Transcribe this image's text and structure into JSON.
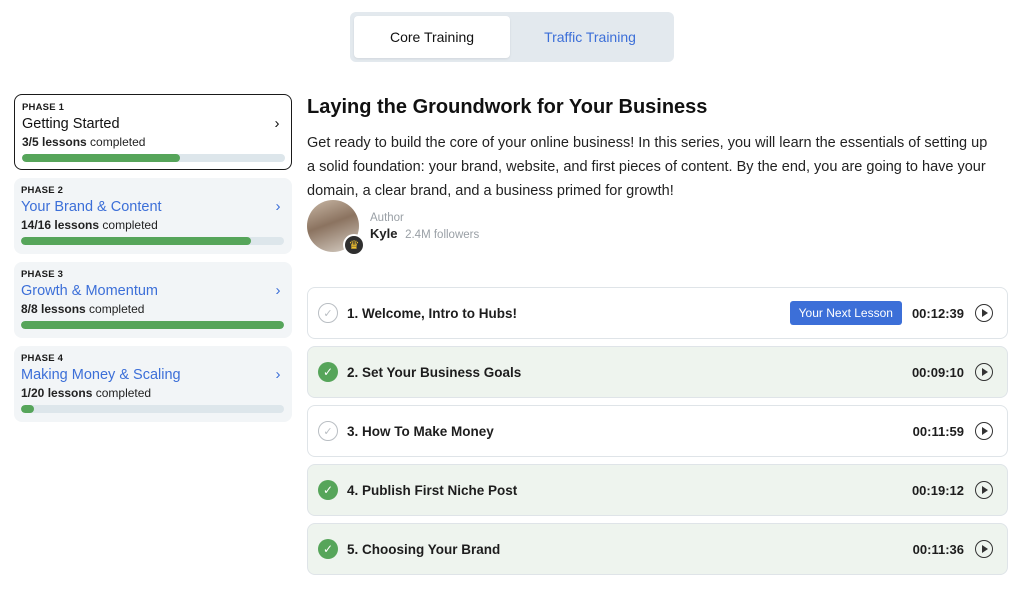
{
  "tabs": [
    {
      "label": "Core Training",
      "active": true
    },
    {
      "label": "Traffic Training",
      "active": false
    }
  ],
  "phases": [
    {
      "kicker": "PHASE 1",
      "title": "Getting Started",
      "completed": "3/5 lessons",
      "suffix": " completed",
      "progress": 0.6
    },
    {
      "kicker": "PHASE 2",
      "title": "Your Brand & Content",
      "completed": "14/16 lessons",
      "suffix": " completed",
      "progress": 0.875
    },
    {
      "kicker": "PHASE 3",
      "title": "Growth & Momentum",
      "completed": "8/8 lessons",
      "suffix": " completed",
      "progress": 1.0
    },
    {
      "kicker": "PHASE 4",
      "title": "Making Money & Scaling",
      "completed": "1/20 lessons",
      "suffix": " completed",
      "progress": 0.05
    }
  ],
  "main": {
    "title": "Laying the Groundwork for Your Business",
    "description": "Get ready to build the core of your online business! In this series, you will learn the essentials of setting up a solid foundation: your brand, website, and first pieces of content. By the end, you are going to have your domain, a clear brand, and a business primed for growth!",
    "author": {
      "label": "Author",
      "name": "Kyle",
      "followers": "2.4M followers"
    }
  },
  "lessons": [
    {
      "title": "1. Welcome, Intro to Hubs!",
      "duration": "00:12:39",
      "completed": false,
      "badge": "Your Next Lesson"
    },
    {
      "title": "2. Set Your Business Goals",
      "duration": "00:09:10",
      "completed": true
    },
    {
      "title": "3. How To Make Money",
      "duration": "00:11:59",
      "completed": false
    },
    {
      "title": "4. Publish First Niche Post",
      "duration": "00:19:12",
      "completed": true
    },
    {
      "title": "5. Choosing Your Brand",
      "duration": "00:11:36",
      "completed": true
    }
  ],
  "icons": {
    "chevron": "chevron-right-icon",
    "check": "check-circle-icon",
    "play": "play-circle-icon",
    "crown": "crown-icon"
  },
  "colors": {
    "accent": "#3c6fd8",
    "progress": "#56a55a",
    "completed_bg": "#eef4ee"
  }
}
